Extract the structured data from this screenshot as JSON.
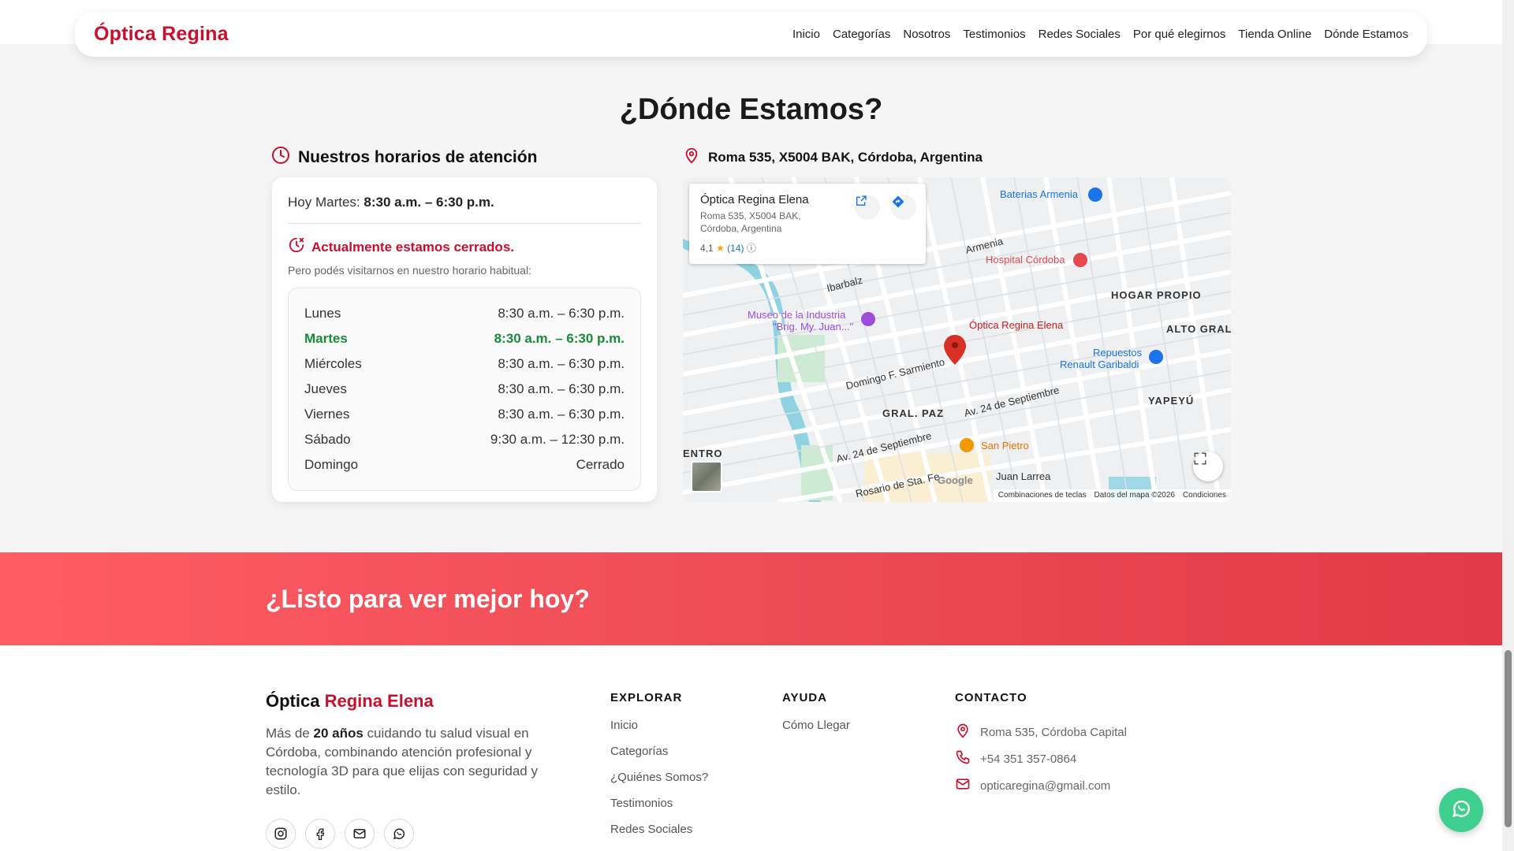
{
  "nav": {
    "logo": "Óptica Regina",
    "links": [
      "Inicio",
      "Categorías",
      "Nosotros",
      "Testimonios",
      "Redes Sociales",
      "Por qué elegirnos",
      "Tienda Online",
      "Dónde Estamos"
    ]
  },
  "location": {
    "title": "¿Dónde Estamos?",
    "hours_heading": "Nuestros horarios de atención",
    "today_prefix": "Hoy Martes:",
    "today_hours": "8:30 a.m. – 6:30 p.m.",
    "closed_text": "Actualmente estamos cerrados.",
    "visit_text": "Pero podés visitarnos en nuestro horario habitual:",
    "schedule": [
      {
        "day": "Lunes",
        "hours": "8:30 a.m. – 6:30 p.m."
      },
      {
        "day": "Martes",
        "hours": "8:30 a.m. – 6:30 p.m."
      },
      {
        "day": "Miércoles",
        "hours": "8:30 a.m. – 6:30 p.m."
      },
      {
        "day": "Jueves",
        "hours": "8:30 a.m. – 6:30 p.m."
      },
      {
        "day": "Viernes",
        "hours": "8:30 a.m. – 6:30 p.m."
      },
      {
        "day": "Sábado",
        "hours": "9:30 a.m. – 12:30 p.m."
      },
      {
        "day": "Domingo",
        "hours": "Cerrado"
      }
    ],
    "address": "Roma 535, X5004 BAK, Córdoba, Argentina"
  },
  "map": {
    "place_name": "Óptica Regina Elena",
    "place_address": "Roma 535, X5004 BAK, Córdoba, Argentina",
    "rating": "4,1",
    "rating_stars": "★",
    "review_count": "(14)",
    "info_icon": "ⓘ",
    "pin_label": "Óptica Regina Elena",
    "labels": {
      "baterias": "Baterias Armenia",
      "hospital": "Hospital Córdoba",
      "hogar": "HOGAR PROPIO",
      "alto": "ALTO GRAL",
      "museo1": "Museo de la Industria",
      "museo2": "\"Brig. My. Juan...\"",
      "repuestos1": "Repuestos",
      "repuestos2": "Renault Garibaldi",
      "yapeyu": "YAPEYÚ",
      "gralpaz": "GRAL. PAZ",
      "sanpietro": "San Pietro",
      "entro": "ENTRO",
      "armenia": "Armenia",
      "ibarbalz": "Ibarbalz",
      "sarmiento": "Domingo F. Sarmiento",
      "sept1": "Av. 24 de Septiembre",
      "sept2": "Av. 24 de Septiembre",
      "juanlarrea": "Juan Larrea",
      "rosario": "Rosario de Sta. Fe",
      "google": "Google"
    },
    "footer": [
      "Combinaciones de teclas",
      "Datos del mapa ©2026",
      "Condiciones"
    ]
  },
  "cta": {
    "title": "¿Listo para ver mejor hoy?"
  },
  "footer": {
    "brand_a": "Óptica ",
    "brand_b": "Regina Elena",
    "desc_a": "Más de ",
    "desc_b": "20 años",
    "desc_c": " cuidando tu salud visual en Córdoba, combinando atención profesional y tecnología 3D para que elijas con seguridad y estilo.",
    "explorar_title": "EXPLORAR",
    "explorar": [
      "Inicio",
      "Categorías",
      "¿Quiénes Somos?",
      "Testimonios",
      "Redes Sociales"
    ],
    "ayuda_title": "AYUDA",
    "ayuda": [
      "Cómo Llegar"
    ],
    "contacto_title": "CONTACTO",
    "contacto": {
      "address": "Roma 535, Córdoba Capital",
      "phone": "+54 351 357-0864",
      "email": "opticaregina@gmail.com"
    }
  },
  "colors": {
    "brand_red": "#c8102e",
    "open_green": "#1a8a3a",
    "whatsapp": "#3fcf8e",
    "cta_gradient_start": "#ff5c63",
    "cta_gradient_end": "#e23a48"
  },
  "icons": [
    "clock-icon",
    "clock-closed-icon",
    "location-pin-icon",
    "external-link-icon",
    "directions-icon",
    "fullscreen-icon",
    "instagram-icon",
    "facebook-icon",
    "mail-icon",
    "whatsapp-icon",
    "phone-icon"
  ]
}
